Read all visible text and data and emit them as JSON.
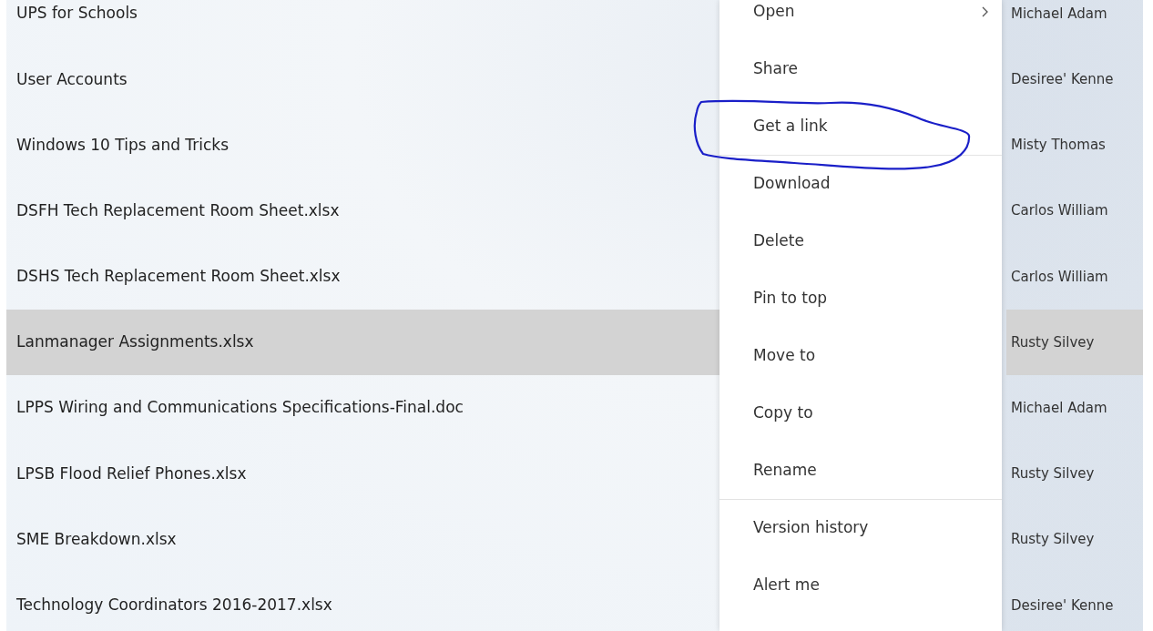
{
  "files": [
    {
      "name": "UPS for Schools",
      "owner": "Michael Adam",
      "selected": false
    },
    {
      "name": "User Accounts",
      "owner": "Desiree' Kenne",
      "selected": false
    },
    {
      "name": "Windows 10 Tips and Tricks",
      "owner": "Misty Thomas",
      "selected": false
    },
    {
      "name": "DSFH Tech Replacement Room Sheet.xlsx",
      "owner": "Carlos William",
      "selected": false
    },
    {
      "name": "DSHS Tech Replacement Room Sheet.xlsx",
      "owner": "Carlos William",
      "selected": false
    },
    {
      "name": "Lanmanager Assignments.xlsx",
      "owner": "Rusty Silvey",
      "selected": true
    },
    {
      "name": "LPPS Wiring and Communications Specifications-Final.doc",
      "owner": "Michael Adam",
      "selected": false
    },
    {
      "name": "LPSB Flood Relief Phones.xlsx",
      "owner": "Rusty Silvey",
      "selected": false
    },
    {
      "name": "SME Breakdown.xlsx",
      "owner": "Rusty Silvey",
      "selected": false
    },
    {
      "name": "Technology Coordinators 2016-2017.xlsx",
      "owner": "Desiree' Kenne",
      "selected": false
    }
  ],
  "context_menu": {
    "items": [
      {
        "label": "Open",
        "submenu": true,
        "separator_before": false,
        "circled": false
      },
      {
        "label": "Share",
        "submenu": false,
        "separator_before": false,
        "circled": false
      },
      {
        "label": "Get a link",
        "submenu": false,
        "separator_before": false,
        "circled": true
      },
      {
        "label": "Download",
        "submenu": false,
        "separator_before": true,
        "circled": false
      },
      {
        "label": "Delete",
        "submenu": false,
        "separator_before": false,
        "circled": false
      },
      {
        "label": "Pin to top",
        "submenu": false,
        "separator_before": false,
        "circled": false
      },
      {
        "label": "Move to",
        "submenu": false,
        "separator_before": false,
        "circled": false
      },
      {
        "label": "Copy to",
        "submenu": false,
        "separator_before": false,
        "circled": false
      },
      {
        "label": "Rename",
        "submenu": false,
        "separator_before": false,
        "circled": false
      },
      {
        "label": "Version history",
        "submenu": false,
        "separator_before": true,
        "circled": false
      },
      {
        "label": "Alert me",
        "submenu": false,
        "separator_before": false,
        "circled": false
      }
    ]
  }
}
